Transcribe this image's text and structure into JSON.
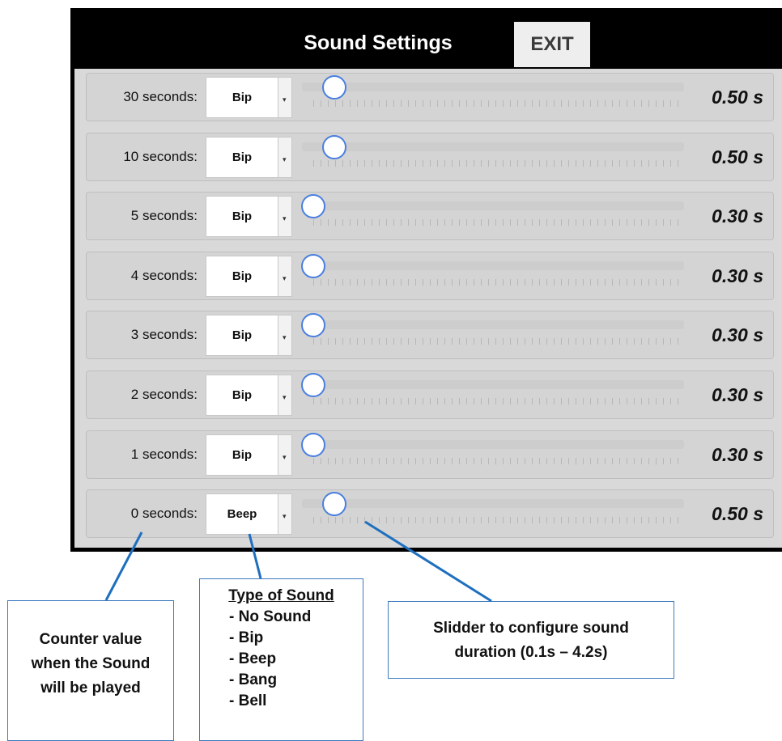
{
  "header": {
    "title": "Sound Settings",
    "exit_label": "EXIT"
  },
  "rows": [
    {
      "label": "30 seconds:",
      "sound": "Bip",
      "duration": "0.50 s",
      "slider_value": 0.5
    },
    {
      "label": "10 seconds:",
      "sound": "Bip",
      "duration": "0.50 s",
      "slider_value": 0.5
    },
    {
      "label": "5 seconds:",
      "sound": "Bip",
      "duration": "0.30 s",
      "slider_value": 0.3
    },
    {
      "label": "4 seconds:",
      "sound": "Bip",
      "duration": "0.30 s",
      "slider_value": 0.3
    },
    {
      "label": "3 seconds:",
      "sound": "Bip",
      "duration": "0.30 s",
      "slider_value": 0.3
    },
    {
      "label": "2 seconds:",
      "sound": "Bip",
      "duration": "0.30 s",
      "slider_value": 0.3
    },
    {
      "label": "1 seconds:",
      "sound": "Bip",
      "duration": "0.30 s",
      "slider_value": 0.3
    },
    {
      "label": "0 seconds:",
      "sound": "Beep",
      "duration": "0.50 s",
      "slider_value": 0.5
    }
  ],
  "slider_range": {
    "min": 0.1,
    "max": 4.2
  },
  "callouts": {
    "counter": [
      "Counter value",
      "when the Sound",
      "will be played"
    ],
    "sound_type": {
      "heading": "Type of Sound",
      "options": [
        "- No Sound",
        "- Bip",
        "- Beep",
        "- Bang",
        "- Bell"
      ]
    },
    "slider": [
      "Slidder to configure sound",
      "duration (0.1s – 4.2s)"
    ]
  },
  "colors": {
    "titlebar": "#000000",
    "panel": "#d9d9d9",
    "thumb_border": "#4a7fe0",
    "callout_line": "#1f6fbf"
  }
}
